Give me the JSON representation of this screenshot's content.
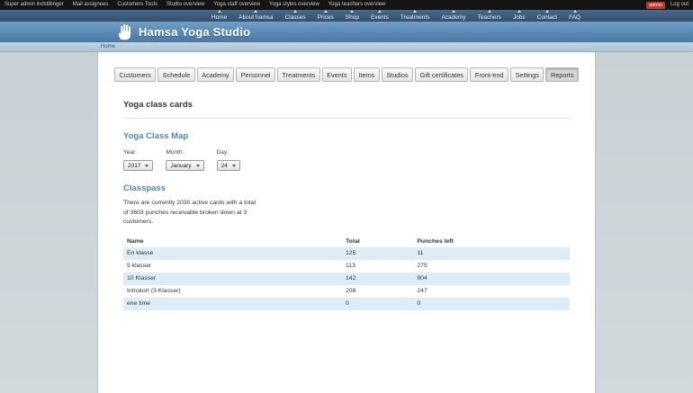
{
  "admin_bar": {
    "items": [
      "Super admin indstillinger",
      "Mail assignees",
      "Customers Tools",
      "Studio overview",
      "Yoga staff overview",
      "Yoga styles overview",
      "Yoga teachers overview"
    ],
    "badge": "admin",
    "logout": "Log out"
  },
  "nav": {
    "items": [
      "Home",
      "About hamsa",
      "Classes",
      "Prices",
      "Shop",
      "Events",
      "Treatments",
      "Academy",
      "Teachers",
      "Jobs",
      "Contact",
      "FAQ"
    ]
  },
  "header": {
    "title": "Hamsa Yoga Studio",
    "logo_icon": "hamsa-hand-icon"
  },
  "breadcrumb": {
    "home": "Home"
  },
  "tabs": {
    "labels": [
      "Customers",
      "Schedule",
      "Academy",
      "Personnel",
      "Treatments",
      "Events",
      "Items",
      "Studios",
      "Gift certificates",
      "Front-end",
      "Settings",
      "Reports"
    ],
    "active": "Reports"
  },
  "page": {
    "title": "Yoga class cards",
    "map_section": {
      "heading": "Yoga Class Map",
      "year_label": "Year:",
      "month_label": "Month:",
      "day_label": "Day:",
      "year_value": "2017",
      "month_value": "January",
      "day_value": "24"
    },
    "classpass": {
      "heading": "Classpass",
      "summary": "There are currently 2030 active cards with a total of 3603 punches receivable broken down at 3 customers.",
      "table": {
        "headers": [
          "Name",
          "Total",
          "Punches left"
        ],
        "rows": [
          [
            "En klasse",
            "125",
            "11"
          ],
          [
            "5 klasser",
            "113",
            "275"
          ],
          [
            "10 Klasser",
            "142",
            "904"
          ],
          [
            "Introkort (3 Klasser)",
            "208",
            "247"
          ],
          [
            "ene time",
            "0",
            "0"
          ]
        ]
      }
    }
  },
  "colors": {
    "accent_heading": "#4e86b4",
    "row_stripe": "#dcedf8",
    "admin_badge": "#c0392b",
    "nav_bar": "#34506c",
    "header_blue": "#4878a4"
  }
}
